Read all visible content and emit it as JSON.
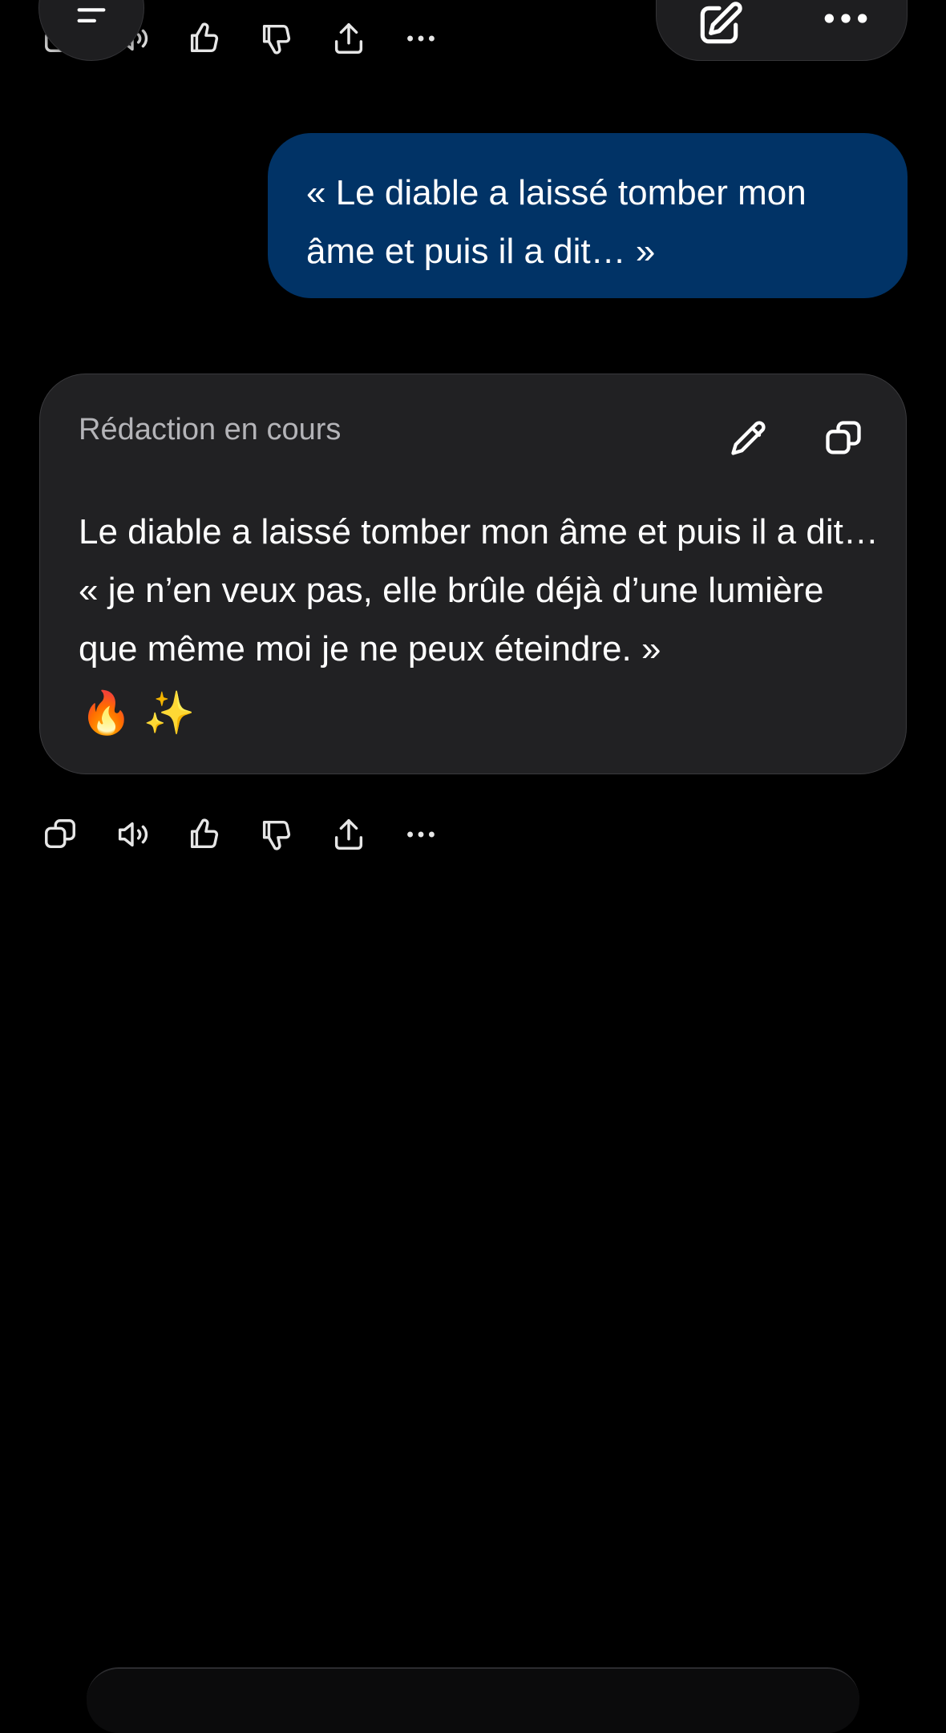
{
  "colors": {
    "background": "#000000",
    "user_bubble": "#013366",
    "card_bg": "#212123",
    "icon": "#e6e6e6"
  },
  "top_actions": {
    "icons": [
      "copy-icon",
      "speaker-icon",
      "thumbs-up-icon",
      "thumbs-down-icon",
      "share-icon",
      "more-icon"
    ]
  },
  "header": {
    "menu_icon": "menu-icon",
    "edit_icon": "new-chat-icon",
    "more_icon": "more-icon"
  },
  "user_message": {
    "text": "« Le diable a laissé tomber mon âme et puis il a dit… »"
  },
  "draft": {
    "header_label": "Rédaction en cours",
    "body_text": "Le diable a laissé tomber mon âme et puis il a dit… « je n’en veux pas, elle brûle déjà d’une lumière que même moi je ne peux éteindre. »",
    "emoji_1": "🔥",
    "emoji_2": "✨"
  },
  "bottom_actions": {
    "icons": [
      "copy-icon",
      "speaker-icon",
      "thumbs-up-icon",
      "thumbs-down-icon",
      "share-icon",
      "more-icon"
    ]
  }
}
